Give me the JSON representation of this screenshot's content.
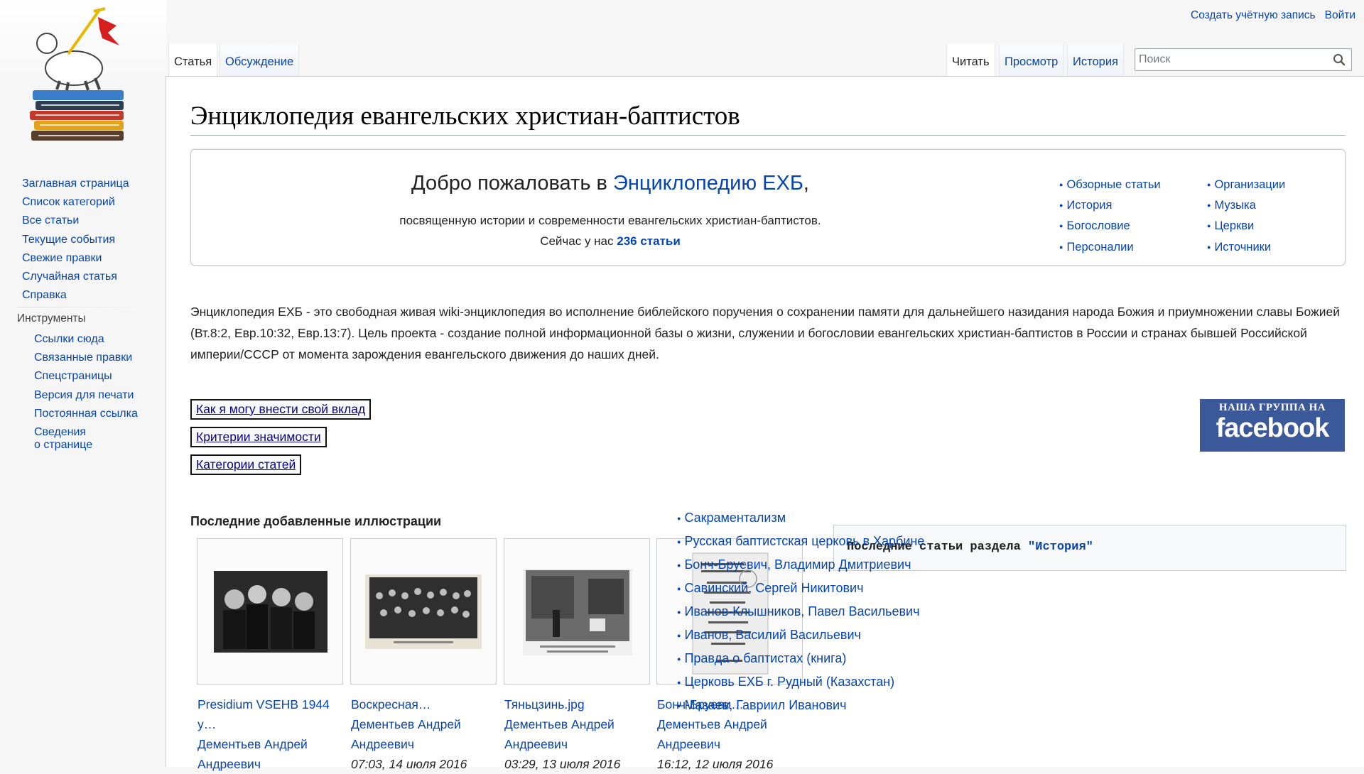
{
  "header": {
    "create_account": "Создать учётную запись",
    "login": "Войти",
    "tabs": {
      "article": "Статья",
      "talk": "Обсуждение",
      "read": "Читать",
      "view_source": "Просмотр",
      "history": "История"
    },
    "search_placeholder": "Поиск"
  },
  "sidebar": {
    "nav": [
      "Заглавная страница",
      "Список категорий",
      "Все статьи",
      "Текущие события",
      "Свежие правки",
      "Случайная статья",
      "Справка"
    ],
    "tools_heading": "Инструменты",
    "tools": [
      "Ссылки сюда",
      "Связанные правки",
      "Спецстраницы",
      "Версия для печати",
      "Постоянная ссылка"
    ],
    "tools_info_line1": "Сведения",
    "tools_info_line2": "о странице"
  },
  "page": {
    "title": "Энциклопедия евангельских христиан-баптистов",
    "welcome": {
      "prefix": "Добро пожаловать в ",
      "link": "Энциклопедию ЕХБ",
      "suffix": ",",
      "description": "посвященную истории и современности евангельских христиан-баптистов.",
      "count_prefix": "Сейчас у нас ",
      "count_link": "236 статьи"
    },
    "portals_col1": [
      "Обзорные статьи",
      "История",
      "Богословие",
      "Персоналии"
    ],
    "portals_col2": [
      "Организации",
      "Музыка",
      "Церкви",
      "Источники"
    ],
    "intro": "Энциклопедия ЕХБ - это свободная живая wiki-энциклопедия во исполнение библейского поручения о сохранении памяти для дальнейшего назидания народа Божия и приумножении славы Божией (Вт.8:2, Евр.10:32, Евр.13:7). Цель проекта - создание полной информационной базы о жизни, служении и богословии евангельских христиан-баптистов в России и странах бывшей Российской империи/СССР от момента зарождения евангельского движения до наших дней.",
    "links": {
      "contribute": "Как я могу внести свой вклад",
      "criteria": "Критерии значимости",
      "categories": "Категории статей"
    },
    "facebook_banner": {
      "top": "НАША ГРУППА НА",
      "word": "facebook"
    },
    "gallery": {
      "heading": "Последние добавленные иллюстрации",
      "items": [
        {
          "title_line1": "Presidium VSEHB 1944",
          "title_line2": "y…",
          "author_line1": "Дементьев Андрей",
          "author_line2": "Андреевич",
          "date": ""
        },
        {
          "title_line1": "Воскресная…",
          "title_line2": "",
          "author_line1": "Дементьев Андрей",
          "author_line2": "Андреевич",
          "date": "07:03, 14 июля 2016"
        },
        {
          "title_line1": "Тяньцзинь.jpg",
          "title_line2": "",
          "author_line1": "Дементьев Андрей",
          "author_line2": "Андреевич",
          "date": "03:29, 13 июля 2016"
        },
        {
          "title_line1": "Бонч-Бруеви…",
          "title_line2": "",
          "author_line1": "Дементьев Андрей",
          "author_line2": "Андреевич",
          "date": "16:12, 12 июля 2016"
        }
      ]
    },
    "recent": {
      "title_prefix": "Последние статьи раздела ",
      "title_link": "\"История\"",
      "items": [
        "Сакраментализм",
        "Русская баптистская церковь в Харбине",
        "Бонч-Бруевич, Владимир Дмитриевич",
        "Савинский, Сергей Никитович",
        "Иванов-Клышников, Павел Васильевич",
        "Иванов, Василий Васильевич",
        "Правда о баптистах (книга)",
        "Церковь ЕХБ г. Рудный (Казахстан)",
        "Мазаев, Гавриил Иванович"
      ]
    }
  }
}
